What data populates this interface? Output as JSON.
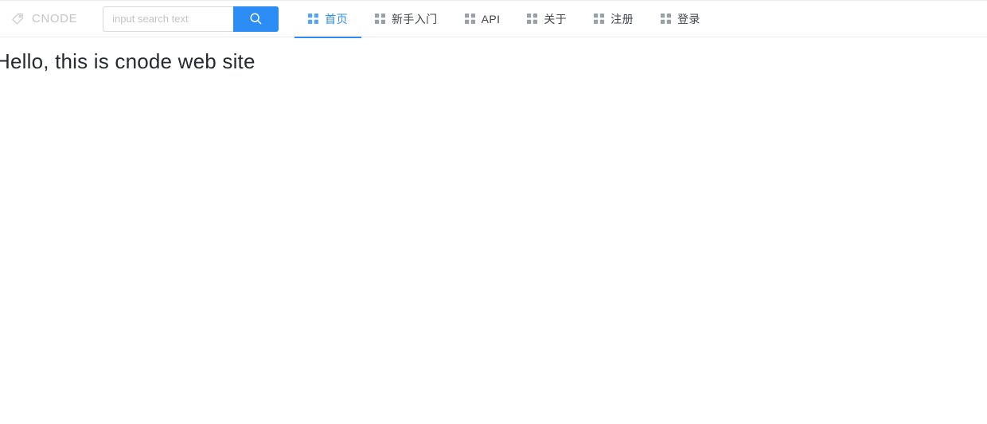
{
  "header": {
    "brand": {
      "icon": "tag-icon",
      "name": "CNODE"
    },
    "search": {
      "placeholder": "input search text",
      "value": "",
      "button_icon": "search-icon",
      "button_color": "#2b8cf5"
    },
    "nav": {
      "active_index": 0,
      "active_color": "#2b8cf5",
      "items": [
        {
          "label": "首页",
          "icon": "appstore-grid-icon",
          "active": true
        },
        {
          "label": "新手入门",
          "icon": "appstore-grid-icon",
          "active": false
        },
        {
          "label": "API",
          "icon": "appstore-grid-icon",
          "active": false
        },
        {
          "label": "关于",
          "icon": "appstore-grid-icon",
          "active": false
        },
        {
          "label": "注册",
          "icon": "appstore-grid-icon",
          "active": false
        },
        {
          "label": "登录",
          "icon": "appstore-grid-icon",
          "active": false
        }
      ]
    }
  },
  "main": {
    "heading": "Hello, this is cnode web site"
  }
}
